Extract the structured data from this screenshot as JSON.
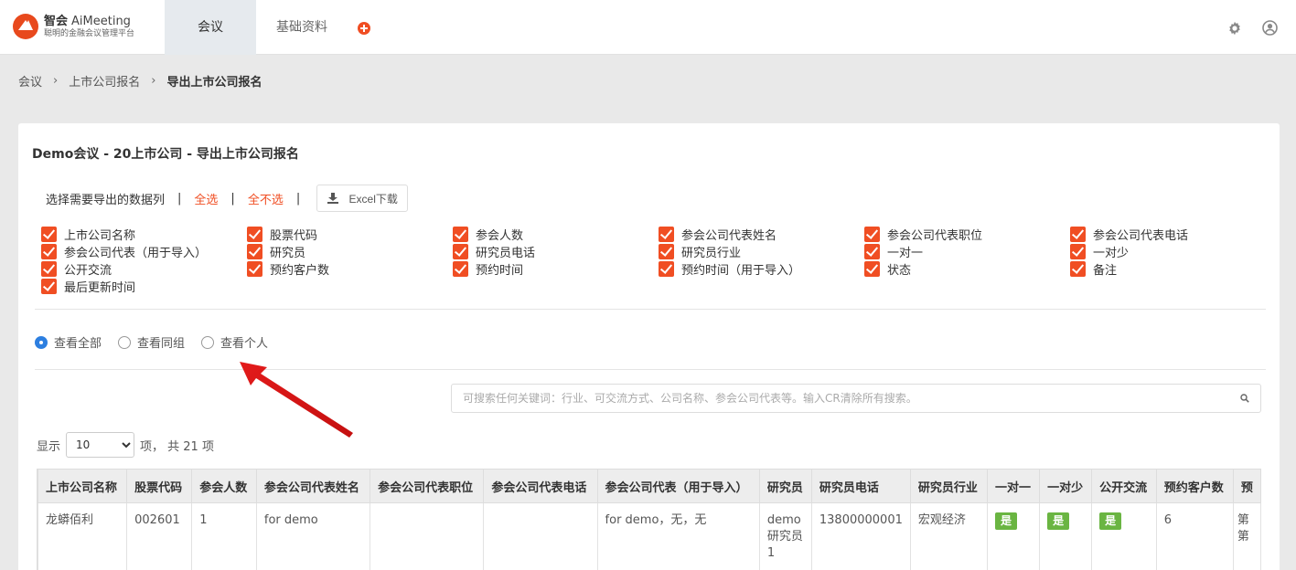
{
  "header": {
    "logo_title": "智会",
    "logo_title_en": "AiMeeting",
    "logo_subtitle": "聪明的金融会议管理平台",
    "tabs": [
      {
        "label": "会议"
      },
      {
        "label": "基础资料"
      }
    ]
  },
  "breadcrumb": [
    "会议",
    "上市公司报名",
    "导出上市公司报名"
  ],
  "card": {
    "title": "Demo会议 - 20上市公司 - 导出上市公司报名",
    "select_label": "选择需要导出的数据列",
    "select_all": "全选",
    "select_none": "全不选",
    "excel_label": "Excel下载"
  },
  "columns_checkboxes": [
    "上市公司名称",
    "股票代码",
    "参会人数",
    "参会公司代表姓名",
    "参会公司代表职位",
    "参会公司代表电话",
    "参会公司代表（用于导入）",
    "研究员",
    "研究员电话",
    "研究员行业",
    "一对一",
    "一对少",
    "公开交流",
    "预约客户数",
    "预约时间",
    "预约时间（用于导入）",
    "状态",
    "备注",
    "最后更新时间"
  ],
  "view_options": [
    {
      "label": "查看全部",
      "selected": true
    },
    {
      "label": "查看同组",
      "selected": false
    },
    {
      "label": "查看个人",
      "selected": false
    }
  ],
  "search": {
    "placeholder": "可搜索任何关键词：行业、可交流方式、公司名称、参会公司代表等。输入CR清除所有搜索。"
  },
  "length": {
    "prefix": "显示",
    "value": "10",
    "suffix": "项， 共 21 项"
  },
  "table": {
    "headers": [
      "上市公司名称",
      "股票代码",
      "参会人数",
      "参会公司代表姓名",
      "参会公司代表职位",
      "参会公司代表电话",
      "参会公司代表（用于导入）",
      "研究员",
      "研究员电话",
      "研究员行业",
      "一对一",
      "一对少",
      "公开交流",
      "预约客户数",
      "预"
    ],
    "rows": [
      {
        "company": "龙蟒佰利",
        "code": "002601",
        "count": "1",
        "rep_name": "for demo",
        "rep_title": "",
        "rep_phone": "",
        "rep_import": "for demo，无，无",
        "researcher": "demo 研究员 1",
        "researcher_phone": "13800000001",
        "industry": "宏观经济",
        "one_on_one": "是",
        "one_few": "是",
        "public": "是",
        "clients": "6",
        "more": "第 第"
      }
    ]
  },
  "colors": {
    "accent": "#f04e23",
    "radio_selected": "#2d7fe0",
    "badge_yes": "#6ab542",
    "annotation_arrow": "#e02020"
  }
}
